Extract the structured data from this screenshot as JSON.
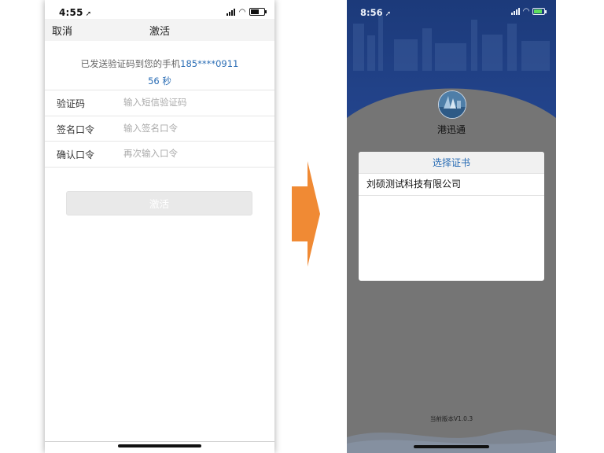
{
  "left_screen": {
    "status": {
      "time": "4:55"
    },
    "nav": {
      "cancel_label": "取消",
      "title": "激活"
    },
    "sms_notice": {
      "text": "已发送验证码到您的手机",
      "phone": "185****0911"
    },
    "countdown": "56 秒",
    "form": [
      {
        "label": "验证码",
        "placeholder": "输入短信验证码",
        "value": ""
      },
      {
        "label": "签名口令",
        "placeholder": "输入签名口令",
        "value": ""
      },
      {
        "label": "确认口令",
        "placeholder": "再次输入口令",
        "value": ""
      }
    ],
    "activate_button": "激活"
  },
  "arrow_color": "#f08a34",
  "right_screen": {
    "status": {
      "time": "8:56"
    },
    "app_name": "港迅通",
    "dialog": {
      "title": "选择证书",
      "items": [
        "刘硕测试科技有限公司"
      ]
    },
    "version": "当前版本V1.0.3"
  },
  "colors": {
    "link_blue": "#2a6db5",
    "header_blue": "#1f3f80",
    "overlay_gray": "#757575"
  }
}
